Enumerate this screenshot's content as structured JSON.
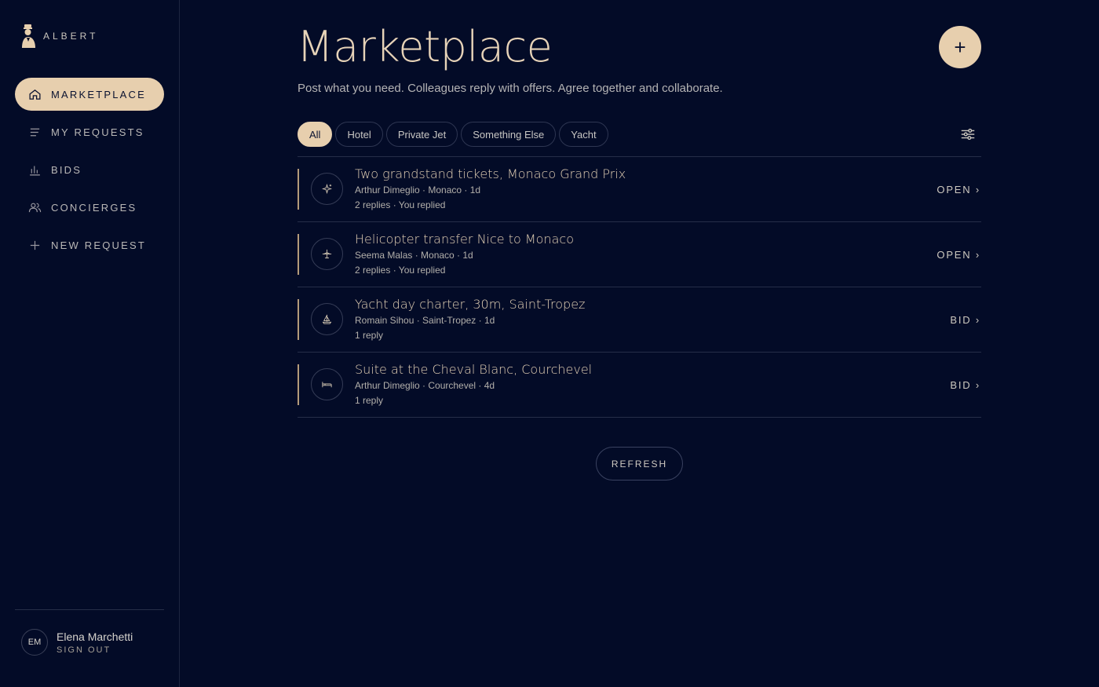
{
  "app": {
    "brand": "ALBERT"
  },
  "sidebar": {
    "items": [
      {
        "label": "MARKETPLACE",
        "icon": "home-icon",
        "active": true
      },
      {
        "label": "MY REQUESTS",
        "icon": "list-icon",
        "active": false
      },
      {
        "label": "BIDS",
        "icon": "bar-chart-icon",
        "active": false
      },
      {
        "label": "CONCIERGES",
        "icon": "users-icon",
        "active": false
      },
      {
        "label": "NEW REQUEST",
        "icon": "plus-icon",
        "active": false
      }
    ],
    "user": {
      "initials": "EM",
      "name": "Elena Marchetti",
      "sign_out": "SIGN OUT"
    }
  },
  "main": {
    "title": "Marketplace",
    "subtitle": "Post what you need. Colleagues reply with offers. Agree together and collaborate.",
    "add_button": "+",
    "filters": [
      {
        "label": "All",
        "active": true
      },
      {
        "label": "Hotel",
        "active": false
      },
      {
        "label": "Private Jet",
        "active": false
      },
      {
        "label": "Something Else",
        "active": false
      },
      {
        "label": "Yacht",
        "active": false
      }
    ],
    "requests": [
      {
        "title": "Two grandstand tickets, Monaco Grand Prix",
        "meta": "Arthur Dimeglio · Monaco · 1d",
        "replies": "2 replies · You replied",
        "status": "OPEN ›",
        "icon": "sparkle-icon"
      },
      {
        "title": "Helicopter transfer Nice to Monaco",
        "meta": "Seema Malas · Monaco · 1d",
        "replies": "2 replies · You replied",
        "status": "OPEN ›",
        "icon": "plane-icon"
      },
      {
        "title": "Yacht day charter, 30m, Saint-Tropez",
        "meta": "Romain Sihou · Saint-Tropez · 1d",
        "replies": "1 reply",
        "status": "BID ›",
        "icon": "sailboat-icon"
      },
      {
        "title": "Suite at the Cheval Blanc, Courchevel",
        "meta": "Arthur Dimeglio · Courchevel · 4d",
        "replies": "1 reply",
        "status": "BID ›",
        "icon": "bed-icon"
      }
    ],
    "refresh_label": "REFRESH"
  },
  "colors": {
    "background": "#030b27",
    "accent": "#e7cfae",
    "text_gold": "#e4d1b6"
  }
}
